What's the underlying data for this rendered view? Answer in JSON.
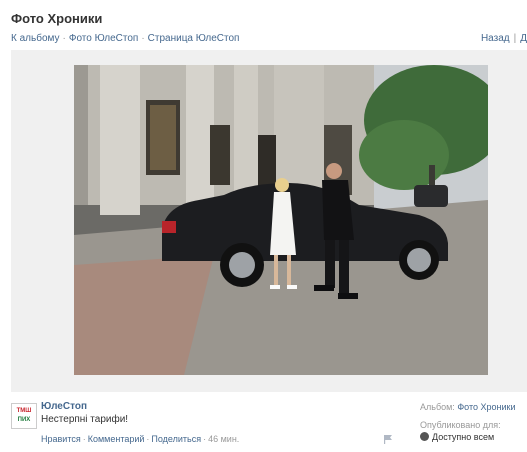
{
  "page": {
    "title": "Фото Хроники"
  },
  "breadcrumbs": {
    "album": "К альбому",
    "photos": "Фото ЮлеСтоп",
    "page": "Страница ЮлеСтоп"
  },
  "nav": {
    "back": "Назад",
    "forward_partial": "Д"
  },
  "photo": {
    "alt": ""
  },
  "post": {
    "author": "ЮлеСтоп",
    "caption": "Нестерпні тарифи!",
    "avatar_line1": "ТМШ",
    "avatar_line2": "ПИХ",
    "like": "Нравится",
    "comment": "Комментарий",
    "share": "Поделиться",
    "time": "46 мин."
  },
  "sidebar": {
    "album_label": "Альбом:",
    "album_name": "Фото Хроники",
    "published_label": "Опубликовано для:",
    "privacy": "Доступно всем"
  },
  "colors": {
    "link": "#45688e",
    "text": "#333333",
    "muted": "#999999",
    "stage": "#f0f0f0"
  }
}
